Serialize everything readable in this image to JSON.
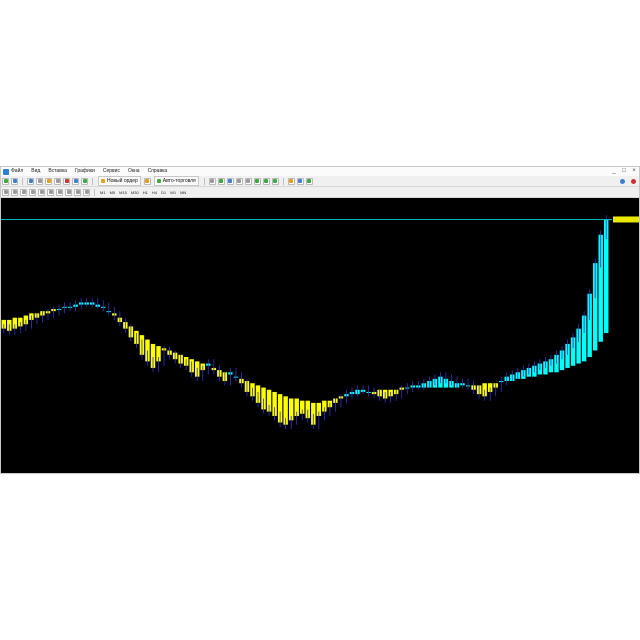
{
  "menubar": {
    "items": [
      "Файл",
      "Вид",
      "Вставка",
      "Графики",
      "Сервис",
      "Окна",
      "Справка"
    ],
    "window_buttons": [
      "_",
      "□",
      "×"
    ]
  },
  "toolbar": {
    "new_order_label": "Новый ордер",
    "auto_trading_label": "Авто-торговля",
    "timeframes": [
      "M1",
      "M5",
      "M15",
      "M30",
      "H1",
      "H4",
      "D1",
      "W1",
      "MN"
    ]
  },
  "chart": {
    "symbol_label": "",
    "current_price_label": "",
    "price_scale": [
      "",
      "",
      "",
      "",
      "",
      "",
      "",
      "",
      "",
      "",
      "",
      "",
      "",
      "",
      "",
      "",
      "",
      ""
    ],
    "time_labels": [
      "",
      "",
      "",
      "",
      "",
      "",
      "",
      "",
      "",
      "",
      "",
      "",
      "",
      "",
      "",
      "",
      "",
      "",
      "",
      ""
    ],
    "colors": {
      "background": "#000000",
      "up_bar": "#00ffff",
      "down_bar": "#ffff00",
      "price_line": "#00b4b4",
      "wick": "#3333cc"
    },
    "close_series": [
      0.62,
      0.61,
      0.62,
      0.63,
      0.64,
      0.66,
      0.67,
      0.68,
      0.69,
      0.7,
      0.71,
      0.72,
      0.72,
      0.73,
      0.74,
      0.74,
      0.74,
      0.73,
      0.72,
      0.7,
      0.68,
      0.65,
      0.62,
      0.58,
      0.55,
      0.5,
      0.47,
      0.44,
      0.47,
      0.52,
      0.5,
      0.48,
      0.46,
      0.45,
      0.42,
      0.4,
      0.43,
      0.46,
      0.43,
      0.4,
      0.38,
      0.42,
      0.4,
      0.37,
      0.33,
      0.31,
      0.28,
      0.25,
      0.24,
      0.22,
      0.19,
      0.18,
      0.2,
      0.22,
      0.23,
      0.21,
      0.18,
      0.22,
      0.24,
      0.26,
      0.28,
      0.3,
      0.32,
      0.33,
      0.34,
      0.34,
      0.33,
      0.32,
      0.31,
      0.3,
      0.31,
      0.32,
      0.34,
      0.35,
      0.36,
      0.36,
      0.37,
      0.38,
      0.39,
      0.4,
      0.39,
      0.38,
      0.37,
      0.37,
      0.36,
      0.34,
      0.32,
      0.31,
      0.33,
      0.35,
      0.38,
      0.4,
      0.41,
      0.42,
      0.43,
      0.44,
      0.45,
      0.46,
      0.47,
      0.48,
      0.5,
      0.52,
      0.55,
      0.58,
      0.62,
      0.68,
      0.78,
      0.92,
      1.05,
      1.12
    ],
    "indicator_series": [
      0.66,
      0.66,
      0.67,
      0.67,
      0.68,
      0.69,
      0.69,
      0.7,
      0.7,
      0.71,
      0.71,
      0.72,
      0.72,
      0.72,
      0.73,
      0.73,
      0.73,
      0.72,
      0.72,
      0.7,
      0.69,
      0.67,
      0.65,
      0.63,
      0.61,
      0.59,
      0.57,
      0.55,
      0.54,
      0.53,
      0.52,
      0.51,
      0.5,
      0.49,
      0.48,
      0.47,
      0.46,
      0.45,
      0.44,
      0.43,
      0.42,
      0.41,
      0.4,
      0.39,
      0.38,
      0.37,
      0.36,
      0.35,
      0.34,
      0.33,
      0.32,
      0.31,
      0.3,
      0.3,
      0.29,
      0.29,
      0.28,
      0.28,
      0.29,
      0.29,
      0.3,
      0.31,
      0.31,
      0.32,
      0.32,
      0.33,
      0.33,
      0.33,
      0.34,
      0.34,
      0.34,
      0.34,
      0.35,
      0.35,
      0.35,
      0.35,
      0.35,
      0.35,
      0.35,
      0.35,
      0.35,
      0.35,
      0.35,
      0.36,
      0.36,
      0.36,
      0.36,
      0.37,
      0.37,
      0.37,
      0.38,
      0.38,
      0.38,
      0.39,
      0.39,
      0.4,
      0.4,
      0.41,
      0.41,
      0.42,
      0.42,
      0.43,
      0.44,
      0.45,
      0.46,
      0.47,
      0.49,
      0.52,
      0.56,
      0.6
    ],
    "current_price_level": 1.12
  }
}
